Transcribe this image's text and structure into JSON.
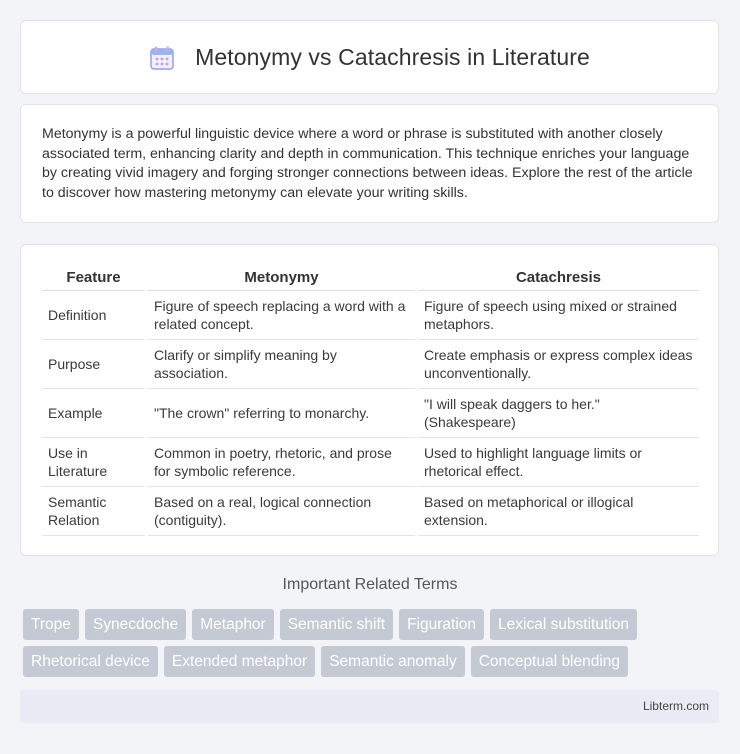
{
  "header": {
    "title": "Metonymy vs Catachresis in Literature",
    "icon": "calendar-icon"
  },
  "intro": {
    "text": "Metonymy is a powerful linguistic device where a word or phrase is substituted with another closely associated term, enhancing clarity and depth in communication. This technique enriches your language by creating vivid imagery and forging stronger connections between ideas. Explore the rest of the article to discover how mastering metonymy can elevate your writing skills."
  },
  "table": {
    "headers": [
      "Feature",
      "Metonymy",
      "Catachresis"
    ],
    "rows": [
      [
        "Definition",
        "Figure of speech replacing a word with a related concept.",
        "Figure of speech using mixed or strained metaphors."
      ],
      [
        "Purpose",
        "Clarify or simplify meaning by association.",
        "Create emphasis or express complex ideas unconventionally."
      ],
      [
        "Example",
        "\"The crown\" referring to monarchy.",
        "\"I will speak daggers to her.\" (Shakespeare)"
      ],
      [
        "Use in Literature",
        "Common in poetry, rhetoric, and prose for symbolic reference.",
        "Used to highlight language limits or rhetorical effect."
      ],
      [
        "Semantic Relation",
        "Based on a real, logical connection (contiguity).",
        "Based on metaphorical or illogical extension."
      ]
    ]
  },
  "related": {
    "title": "Important Related Terms",
    "rows": [
      [
        "Trope",
        "Synecdoche",
        "Metaphor",
        "Semantic shift",
        "Figuration",
        "Lexical substitution"
      ],
      [
        "Rhetorical device",
        "Extended metaphor",
        "Semantic anomaly",
        "Conceptual blending"
      ]
    ]
  },
  "footer": {
    "text": "Libterm.com"
  },
  "colors": {
    "background": "#f3f4f8",
    "tag": "#c5c9d4",
    "footer": "#e9ecf5"
  }
}
